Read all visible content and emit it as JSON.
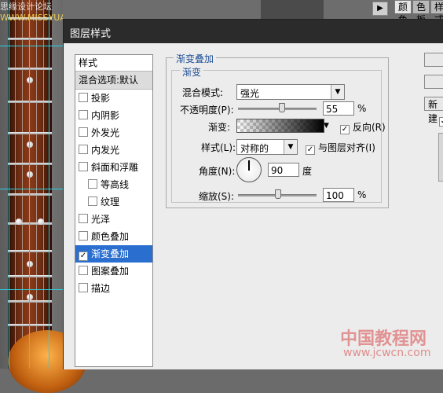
{
  "watermark_top": {
    "left": "思缘设计论坛",
    "right": "WWW.MISSYUAN.COM"
  },
  "top_panel": {
    "toolbar_button": "▶",
    "tabs": [
      {
        "label": "颜色",
        "close": "×",
        "active": true
      },
      {
        "label": "色板",
        "close": "",
        "active": false
      },
      {
        "label": "样式",
        "close": "",
        "active": false
      }
    ]
  },
  "dialog": {
    "title": "图层样式",
    "style_list": {
      "header": "样式",
      "blend_options": "混合选项:默认",
      "items": [
        {
          "label": "投影",
          "checked": false,
          "sub": false,
          "selected": false
        },
        {
          "label": "内阴影",
          "checked": false,
          "sub": false,
          "selected": false
        },
        {
          "label": "外发光",
          "checked": false,
          "sub": false,
          "selected": false
        },
        {
          "label": "内发光",
          "checked": false,
          "sub": false,
          "selected": false
        },
        {
          "label": "斜面和浮雕",
          "checked": false,
          "sub": false,
          "selected": false
        },
        {
          "label": "等高线",
          "checked": false,
          "sub": true,
          "selected": false
        },
        {
          "label": "纹理",
          "checked": false,
          "sub": true,
          "selected": false
        },
        {
          "label": "光泽",
          "checked": false,
          "sub": false,
          "selected": false
        },
        {
          "label": "颜色叠加",
          "checked": false,
          "sub": false,
          "selected": false
        },
        {
          "label": "渐变叠加",
          "checked": true,
          "sub": false,
          "selected": true
        },
        {
          "label": "图案叠加",
          "checked": false,
          "sub": false,
          "selected": false
        },
        {
          "label": "描边",
          "checked": false,
          "sub": false,
          "selected": false
        }
      ]
    },
    "gradient_overlay": {
      "group_title": "渐变叠加",
      "sub_title": "渐变",
      "blend_mode_label": "混合模式:",
      "blend_mode_value": "强光",
      "opacity_label": "不透明度(P):",
      "opacity_value": "55",
      "opacity_unit": "%",
      "opacity_level": 0.55,
      "gradient_label": "渐变:",
      "reverse_label": "反向(R)",
      "reverse_checked": true,
      "style_label": "样式(L):",
      "style_value": "对称的",
      "align_label": "与图层对齐(I)",
      "align_checked": true,
      "angle_label": "角度(N):",
      "angle_value": "90",
      "angle_unit": "度",
      "scale_label": "缩放(S):",
      "scale_value": "100",
      "scale_unit": "%",
      "scale_level": 0.5
    },
    "right_buttons": {
      "new_style": "新建"
    }
  },
  "watermark_bottom": {
    "line1": "中国教程网",
    "line2": "www.jcwcn.com"
  },
  "colors": {
    "selection": "#2a6fcf",
    "group_title": "#1f4f96",
    "guide": "#28d2e6"
  }
}
